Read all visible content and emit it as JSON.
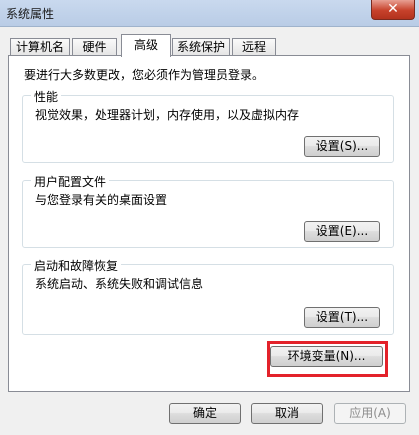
{
  "window": {
    "title": "系统属性",
    "close_glyph": "✕"
  },
  "tabs": [
    {
      "label": "计算机名"
    },
    {
      "label": "硬件"
    },
    {
      "label": "高级"
    },
    {
      "label": "系统保护"
    },
    {
      "label": "远程"
    }
  ],
  "main": {
    "intro": "要进行大多数更改，您必须作为管理员登录。",
    "performance": {
      "title": "性能",
      "description": "视觉效果，处理器计划，内存使用，以及虚拟内存",
      "button": "设置(S)..."
    },
    "user_profiles": {
      "title": "用户配置文件",
      "description": "与您登录有关的桌面设置",
      "button": "设置(E)..."
    },
    "startup_recovery": {
      "title": "启动和故障恢复",
      "description": "系统启动、系统失败和调试信息",
      "button": "设置(T)..."
    },
    "env_button": "环境变量(N)..."
  },
  "footer": {
    "ok": "确定",
    "cancel": "取消",
    "apply": "应用(A)"
  },
  "colors": {
    "highlight": "#e3222a",
    "close": "#c7412b"
  }
}
